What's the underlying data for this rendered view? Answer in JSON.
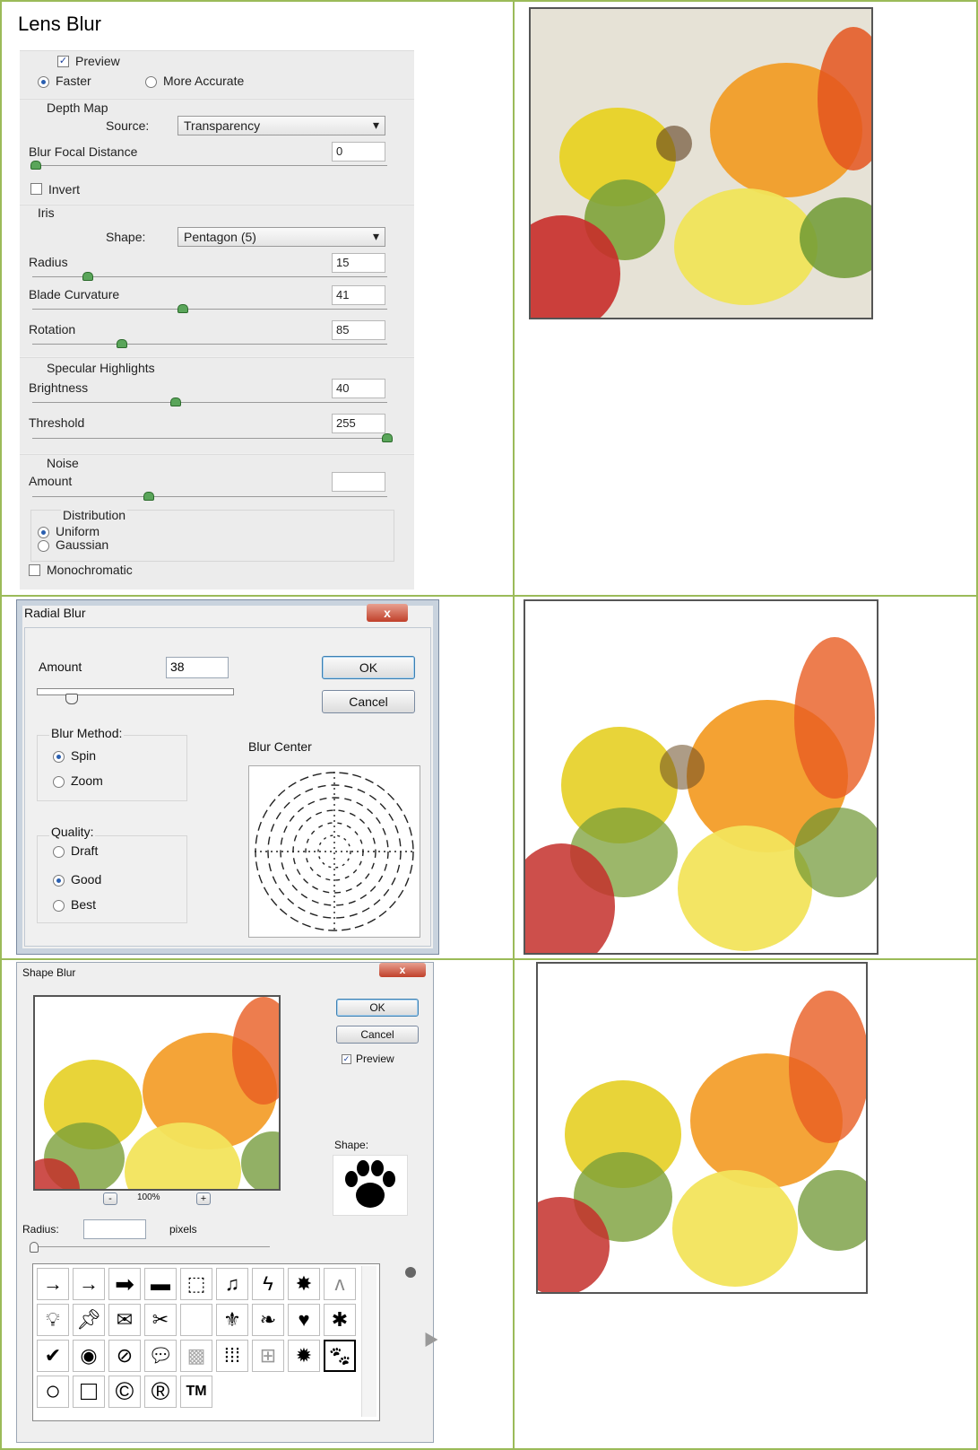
{
  "lens": {
    "title": "Lens Blur",
    "preview": "Preview",
    "faster": "Faster",
    "more_accurate": "More Accurate",
    "depth_map": "Depth Map",
    "source_label": "Source:",
    "source_value": "Transparency",
    "focal_label": "Blur Focal Distance",
    "focal_value": "0",
    "invert": "Invert",
    "iris": "Iris",
    "shape_label": "Shape:",
    "shape_value": "Pentagon (5)",
    "radius_label": "Radius",
    "radius_value": "15",
    "blade_label": "Blade Curvature",
    "blade_value": "41",
    "rotation_label": "Rotation",
    "rotation_value": "85",
    "specular": "Specular Highlights",
    "brightness_label": "Brightness",
    "brightness_value": "40",
    "threshold_label": "Threshold",
    "threshold_value": "255",
    "noise": "Noise",
    "amount_label": "Amount",
    "amount_value": "31",
    "distribution": "Distribution",
    "uniform": "Uniform",
    "gaussian": "Gaussian",
    "monochromatic": "Monochromatic"
  },
  "radial": {
    "title": "Radial Blur",
    "close": "x",
    "amount_label": "Amount",
    "amount_value": "38",
    "ok": "OK",
    "cancel": "Cancel",
    "method_label": "Blur Method:",
    "spin": "Spin",
    "zoom": "Zoom",
    "center_label": "Blur Center",
    "quality_label": "Quality:",
    "draft": "Draft",
    "good": "Good",
    "best": "Best"
  },
  "shape": {
    "title": "Shape Blur",
    "close": "x",
    "ok": "OK",
    "cancel": "Cancel",
    "preview": "Preview",
    "shape_label": "Shape:",
    "zoom_minus": "-",
    "zoom_level": "100%",
    "zoom_plus": "+",
    "radius_label": "Radius:",
    "radius_value": "10",
    "pixels": "pixels",
    "tm": "TM"
  }
}
